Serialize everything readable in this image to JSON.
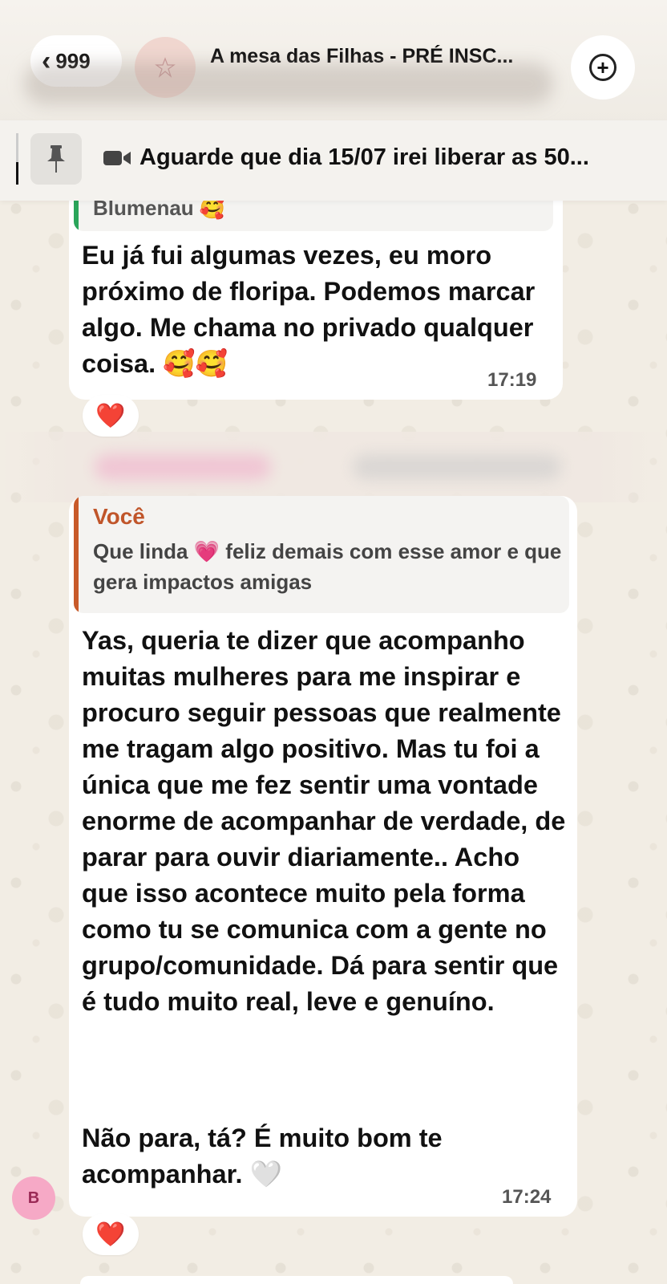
{
  "header": {
    "back_count": "999",
    "back_chevron": "‹",
    "group_title": "A mesa das Filhas - PRÉ INSC...",
    "add_icon": "plus-circle-icon"
  },
  "pinned": {
    "icon": "pin-icon",
    "video_icon": "video-camera-icon",
    "text": "Aguarde que dia 15/07 irei liberar as 50..."
  },
  "messages": [
    {
      "quote_partial": "Blumenau 🥰",
      "text": "Eu já fui algumas vezes, eu moro próximo de floripa. Podemos marcar algo. Me chama no privado qualquer coisa. 🥰🥰",
      "time": "17:19",
      "reaction": "❤️"
    },
    {
      "quote_author": "Você",
      "quote_text": "Que linda 💗 feliz demais com esse amor e que gera impactos amigas",
      "text": "Yas, queria te dizer que acompanho muitas mulheres para me inspirar e procuro seguir pessoas que realmente me tragam algo positivo. Mas tu foi a única que me fez sentir uma vontade enorme de acompanhar de verdade, de parar para ouvir diariamente.. Acho que isso acontece muito pela forma como tu se comunica com a gente no grupo/comunidade. Dá para sentir que é tudo muito real, leve e genuíno.",
      "text2": "Não para, tá? É muito bom te acompanhar. 🤍",
      "time": "17:24",
      "reaction": "❤️",
      "avatar_letter": "B"
    }
  ],
  "colors": {
    "quote_bar_green": "#2aa55a",
    "quote_bar_orange": "#c85a2a",
    "quote_author": "#c0552a",
    "avatar_pink": "#f6a9c6"
  }
}
